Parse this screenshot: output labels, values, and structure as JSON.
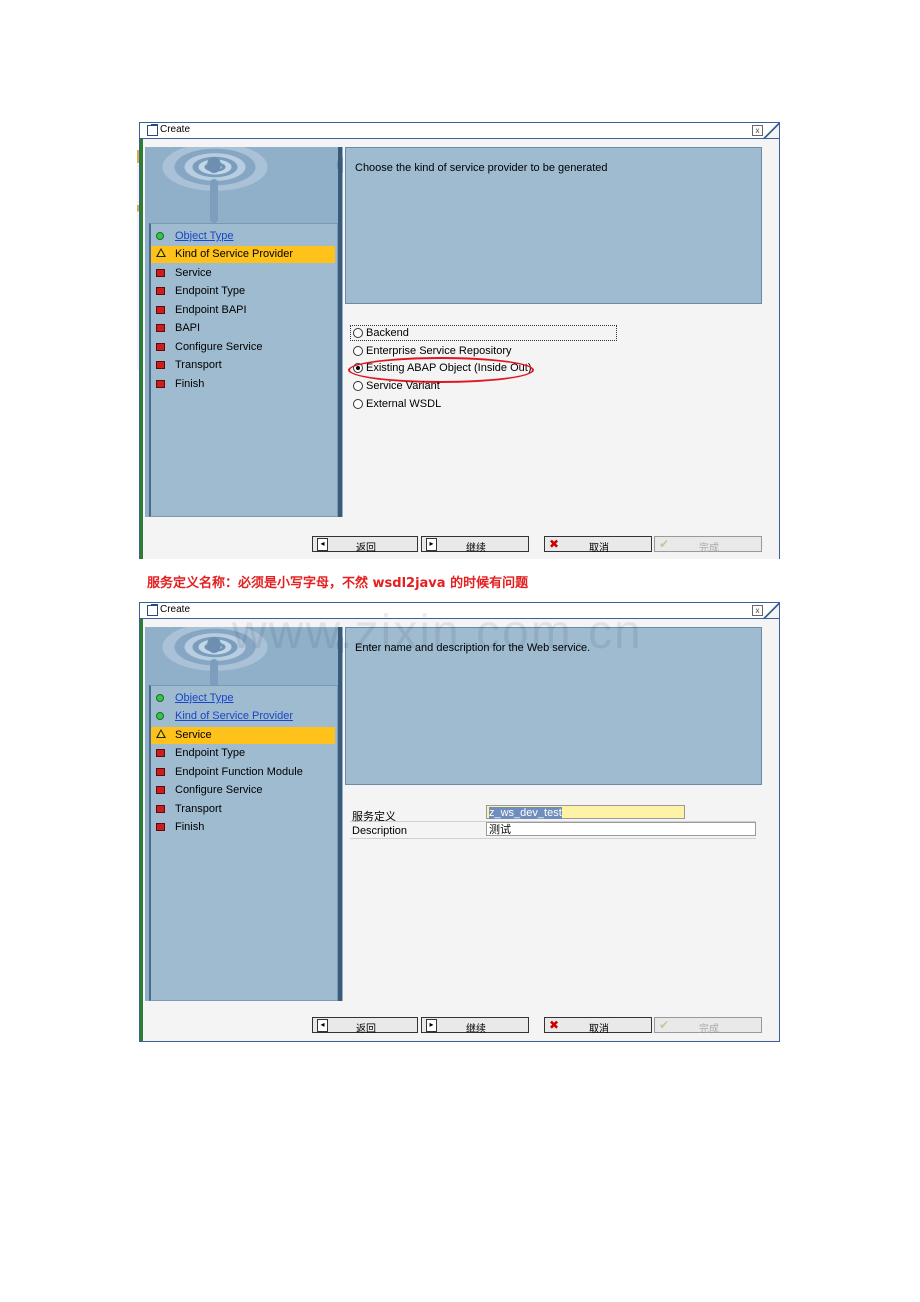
{
  "window1": {
    "title": "Create",
    "close_label": "x",
    "info_text": "Choose the kind of service provider to be generated",
    "steps": [
      {
        "label": "Object Type",
        "state": "done"
      },
      {
        "label": "Kind of Service Provider",
        "state": "current"
      },
      {
        "label": "Service",
        "state": "todo"
      },
      {
        "label": "Endpoint Type",
        "state": "todo"
      },
      {
        "label": "Endpoint BAPI",
        "state": "todo"
      },
      {
        "label": "BAPI",
        "state": "todo"
      },
      {
        "label": "Configure Service",
        "state": "todo"
      },
      {
        "label": "Transport",
        "state": "todo"
      },
      {
        "label": "Finish",
        "state": "todo"
      }
    ],
    "options": [
      {
        "label": "Backend",
        "selected": false
      },
      {
        "label": "Enterprise Service Repository",
        "selected": false
      },
      {
        "label": "Existing ABAP Object (Inside Out)",
        "selected": true
      },
      {
        "label": "Service Variant",
        "selected": false
      },
      {
        "label": "External WSDL",
        "selected": false
      }
    ],
    "buttons": {
      "back": "返回",
      "continue": "继续",
      "cancel": "取消",
      "finish": "完成"
    }
  },
  "caption": "服务定义名称：必须是小写字母，不然 wsdl2java  的时候有问题",
  "watermark": "www.zixin.com.cn",
  "window2": {
    "title": "Create",
    "close_label": "x",
    "info_text": "Enter name and description for the Web service.",
    "steps": [
      {
        "label": "Object Type",
        "state": "done"
      },
      {
        "label": "Kind of Service Provider",
        "state": "done"
      },
      {
        "label": "Service",
        "state": "current"
      },
      {
        "label": "Endpoint Type",
        "state": "todo"
      },
      {
        "label": "Endpoint Function Module",
        "state": "todo"
      },
      {
        "label": "Configure Service",
        "state": "todo"
      },
      {
        "label": "Transport",
        "state": "todo"
      },
      {
        "label": "Finish",
        "state": "todo"
      }
    ],
    "fields": {
      "service_label": "服务定义",
      "service_value": "z_ws_dev_test",
      "description_label": "Description",
      "description_value": "测试"
    },
    "buttons": {
      "back": "返回",
      "continue": "继续",
      "cancel": "取消",
      "finish": "完成"
    }
  },
  "colors": {
    "current_step": "#ffc21a",
    "panel": "#9ebbd0",
    "caption": "#e52020",
    "highlight_ellipse": "#e3141f"
  }
}
